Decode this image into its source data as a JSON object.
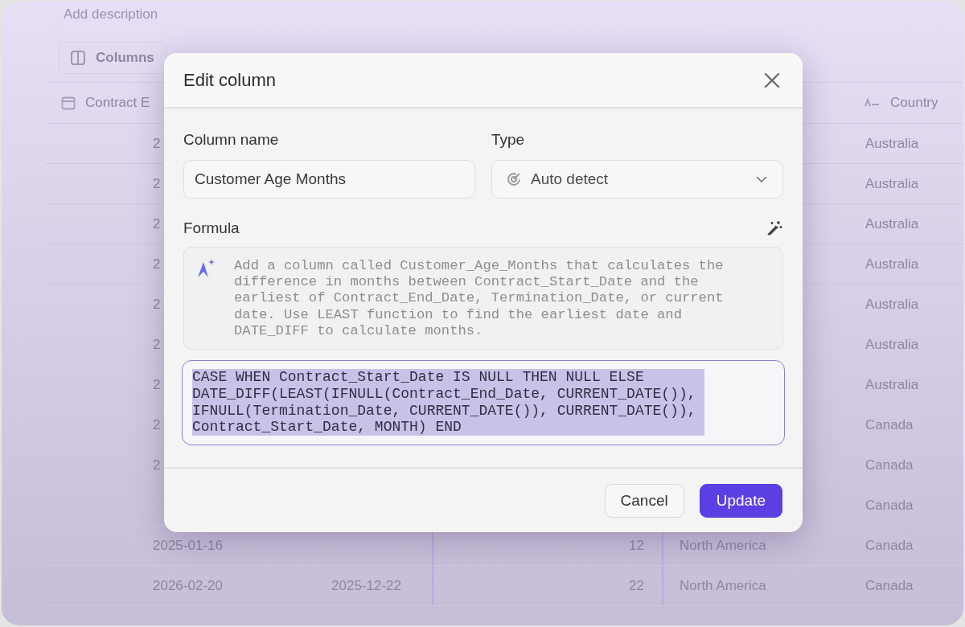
{
  "background": {
    "description_placeholder": "Add description",
    "columns_button": "Columns",
    "table": {
      "headers": [
        {
          "label": "Contract E",
          "kind": "date"
        },
        {
          "label": "Country",
          "kind": "text"
        }
      ],
      "rows": [
        {
          "column_1": "2",
          "country": "Australia"
        },
        {
          "column_1": "2",
          "country": "Australia"
        },
        {
          "column_1": "2",
          "country": "Australia"
        },
        {
          "column_1": "2",
          "country": "Australia"
        },
        {
          "column_1": "2",
          "country": "Australia"
        },
        {
          "column_1": "2",
          "country": "Australia"
        },
        {
          "column_1": "2",
          "country": "Australia"
        },
        {
          "column_1": "2",
          "country": "Canada"
        },
        {
          "column_1": "2",
          "country": "Canada"
        },
        {
          "country": "Canada"
        },
        {
          "column_1": "2025-01-16",
          "column_3": "12",
          "region": "North America",
          "country": "Canada"
        },
        {
          "column_1": "2026-02-20",
          "column_2": "2025-12-22",
          "column_3": "22",
          "region": "North America",
          "country": "Canada"
        }
      ]
    }
  },
  "dialog": {
    "title": "Edit column",
    "column_name": {
      "label": "Column name",
      "value": "Customer Age Months"
    },
    "type": {
      "label": "Type",
      "value": "Auto detect"
    },
    "formula": {
      "label": "Formula",
      "prompt": "Add a column called Customer_Age_Months that calculates the difference in months between Contract_Start_Date and the earliest of Contract_End_Date, Termination_Date, or current date. Use LEAST function to find the earliest date and DATE_DIFF to calculate months.",
      "code": "CASE WHEN Contract_Start_Date IS NULL THEN NULL ELSE DATE_DIFF(LEAST(IFNULL(Contract_End_Date, CURRENT_DATE()), IFNULL(Termination_Date, CURRENT_DATE()), CURRENT_DATE()), Contract_Start_Date, MONTH) END",
      "code_selected": true
    },
    "buttons": [
      {
        "label": "Cancel",
        "kind": "secondary"
      },
      {
        "label": "Update",
        "kind": "primary"
      }
    ]
  }
}
